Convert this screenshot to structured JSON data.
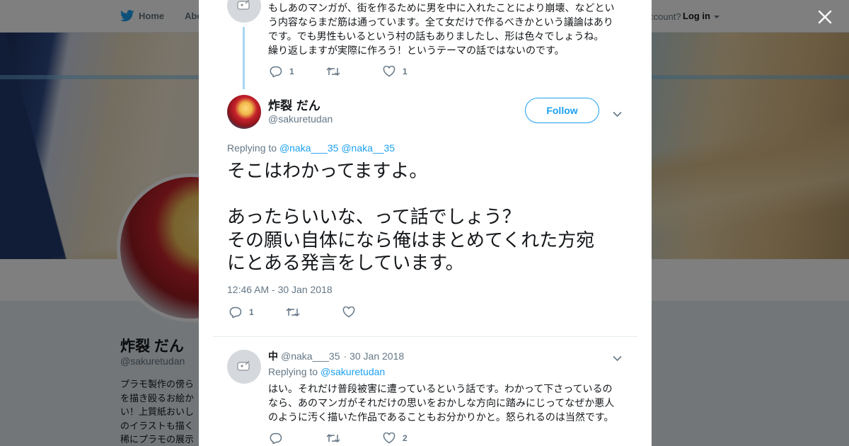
{
  "nav": {
    "home_label": "Home",
    "about_label": "Abo",
    "account_prompt": "ccount?",
    "login_label": "Log in"
  },
  "profile": {
    "name": "炸裂 だん",
    "handle": "@sakuretudan",
    "bio_lines": [
      "プラモ製作の傍ら",
      "を描き殴るお絵か",
      "い！上質紙おいし",
      "のイラストも描く",
      "稀にプラモの展示"
    ]
  },
  "previous_tweet": {
    "text_lines": [
      "もしあのマンガが、街を作るために男を中に入れたことにより崩壊、などとい",
      "う内容ならまだ筋は通っています。全て女だけで作るべきかという議論はあり",
      "です。でも男性もいるという村の話もありましたし、形は色々でしょうね。",
      "繰り返しますが実際に作ろう！というテーマの話ではないのです。"
    ],
    "reply_count": "1",
    "retweet_count": "",
    "like_count": "1"
  },
  "main_tweet": {
    "name": "炸裂 だん",
    "handle": "@sakuretudan",
    "follow_label": "Follow",
    "replying_prefix": "Replying to",
    "mentions": [
      "@naka___35",
      "@naka__35"
    ],
    "text_lines": [
      "そこはわかってますよ。",
      "",
      "あったらいいな、って話でしょう？",
      "その願い自体になら俺はまとめてくれた方宛",
      "にとある発言をしています。"
    ],
    "timestamp": "12:46 AM - 30 Jan 2018",
    "reply_count": "1",
    "retweet_count": "",
    "like_count": ""
  },
  "reply_tweet": {
    "name": "中",
    "handle": "@naka___35",
    "date": "· 30 Jan 2018",
    "replying_prefix": "Replying to",
    "mention": "@sakuretudan",
    "text_lines": [
      "はい。それだけ普段被害に遭っているという話です。わかって下さっているの",
      "なら、あのマンガがそれだけの思いをおかしな方向に踏みにじってなぜか悪人",
      "のように汚く描いた作品であることもお分かりかと。怒られるのは当然です。"
    ],
    "reply_count": "",
    "retweet_count": "",
    "like_count": "2"
  },
  "colors": {
    "accent": "#1da1f2",
    "thread_line": "#a6d4f2",
    "secondary_text": "#657786",
    "primary_text": "#14171a",
    "overlay": "rgba(0,0,0,0.5)"
  },
  "icons": [
    "twitter-bird-icon",
    "caret-down-icon",
    "close-icon",
    "reply-icon",
    "retweet-icon",
    "like-icon",
    "default-avatar-icon"
  ]
}
